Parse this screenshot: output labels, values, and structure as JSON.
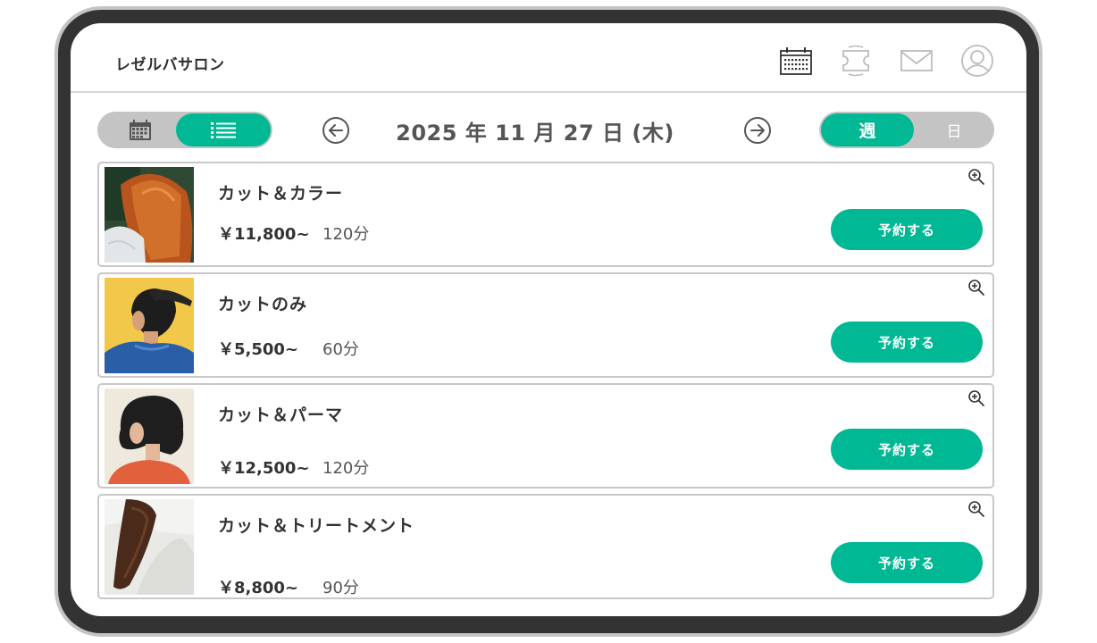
{
  "app": {
    "title": "レゼルバサロン"
  },
  "header_icons": [
    "calendar-icon",
    "ticket-icon",
    "mail-icon",
    "user-icon"
  ],
  "toolbar": {
    "view_toggle": {
      "options": [
        "calendar-view",
        "list-view"
      ],
      "selected": "list-view"
    },
    "date": "2025 年 11 月 27 日 (木)",
    "range_toggle": {
      "week_label": "週",
      "day_label": "日",
      "selected": "週"
    }
  },
  "menus": [
    {
      "name": "カット＆カラー",
      "price": "￥11,800~",
      "duration": "120分",
      "button": "予約する"
    },
    {
      "name": "カットのみ",
      "price": "￥5,500~",
      "duration": "60分",
      "button": "予約する"
    },
    {
      "name": "カット＆パーマ",
      "price": "￥12,500~",
      "duration": "120分",
      "button": "予約する"
    },
    {
      "name": "カット＆トリートメント",
      "price": "￥8,800~",
      "duration": "90分",
      "button": "予約する"
    }
  ],
  "colors": {
    "accent": "#00b894",
    "toggle_bg": "#c4c4c4",
    "bezel": "#333333",
    "card_border": "#c8c8c8"
  }
}
